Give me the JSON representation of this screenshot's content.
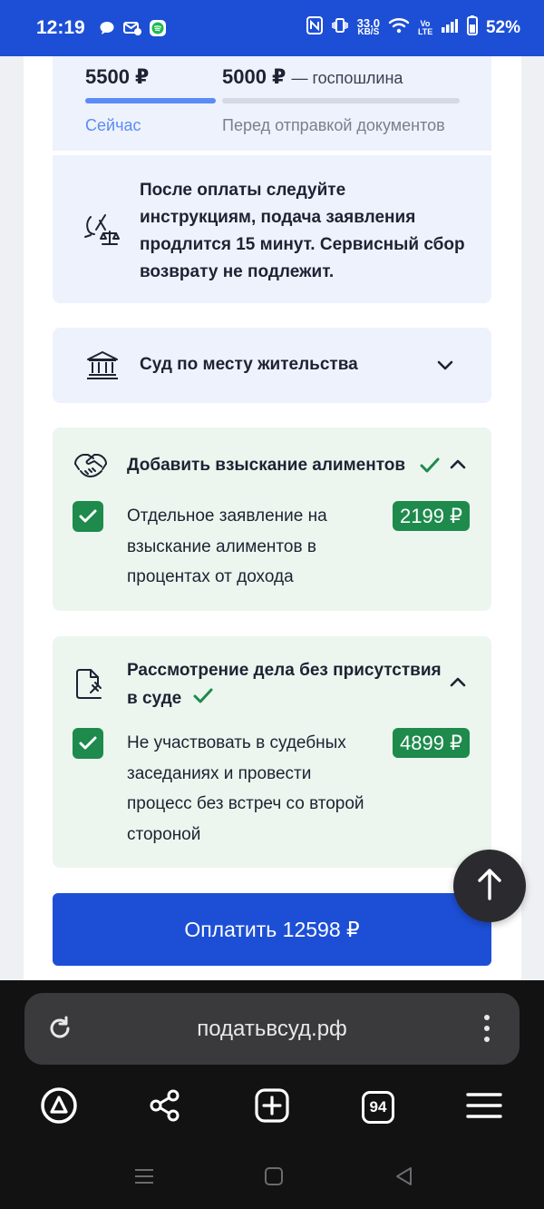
{
  "status_bar": {
    "time": "12:19",
    "speed_value": "33.0",
    "speed_unit": "KB/S",
    "network_label": "Vo LTE",
    "battery": "52%",
    "icons": [
      "chat-bubble-icon",
      "mail-icon",
      "spotify-icon",
      "nfc-icon",
      "vibrate-icon",
      "wifi-icon",
      "signal-icon",
      "battery-icon"
    ]
  },
  "price_summary": {
    "now_amount": "5500 ₽",
    "now_label": "Сейчас",
    "later_amount": "5000 ₽",
    "later_suffix": "— госпошлина",
    "later_label": "Перед отправкой документов",
    "now_progress": 1.0,
    "later_progress": 0.0,
    "colors": {
      "active_bar": "#5b8cf5",
      "inactive_bar": "#d6d9e2",
      "now_label": "#5b8cf5",
      "later_label": "#7a7f8e"
    }
  },
  "info": {
    "text": "После оплаты следуйте инструкциям, подача заявления продлится 15 минут. Сервисный сбор возврату не подлежит.",
    "icon": "scales-icon"
  },
  "court": {
    "label": "Суд по месту жительства",
    "icon": "courthouse-icon",
    "expanded": false
  },
  "options": [
    {
      "title": "Добавить взыскание алиментов",
      "icon": "handshake-icon",
      "checked": true,
      "expanded": true,
      "description": "Отдельное заявление на взыскание алиментов в процентах от дохода",
      "price": "2199 ₽"
    },
    {
      "title": "Рассмотрение дела без присутствия в суде",
      "icon": "document-gavel-icon",
      "checked": true,
      "expanded": true,
      "description": "Не участвовать в судебных заседаниях и провести процесс без встреч со второй стороной",
      "price": "4899 ₽"
    }
  ],
  "pay_button": {
    "label": "Оплатить 12598 ₽"
  },
  "browser": {
    "url": "податьвсуд.рф",
    "tab_count": "94",
    "nav_icons": [
      "alice-icon",
      "share-icon",
      "new-tab-icon",
      "tabs-icon",
      "menu-icon"
    ]
  },
  "colors": {
    "brand_blue": "#1d4fd6",
    "green": "#1e8a4c",
    "panel_blue": "#eef2fd",
    "panel_green": "#ecf6ee"
  }
}
